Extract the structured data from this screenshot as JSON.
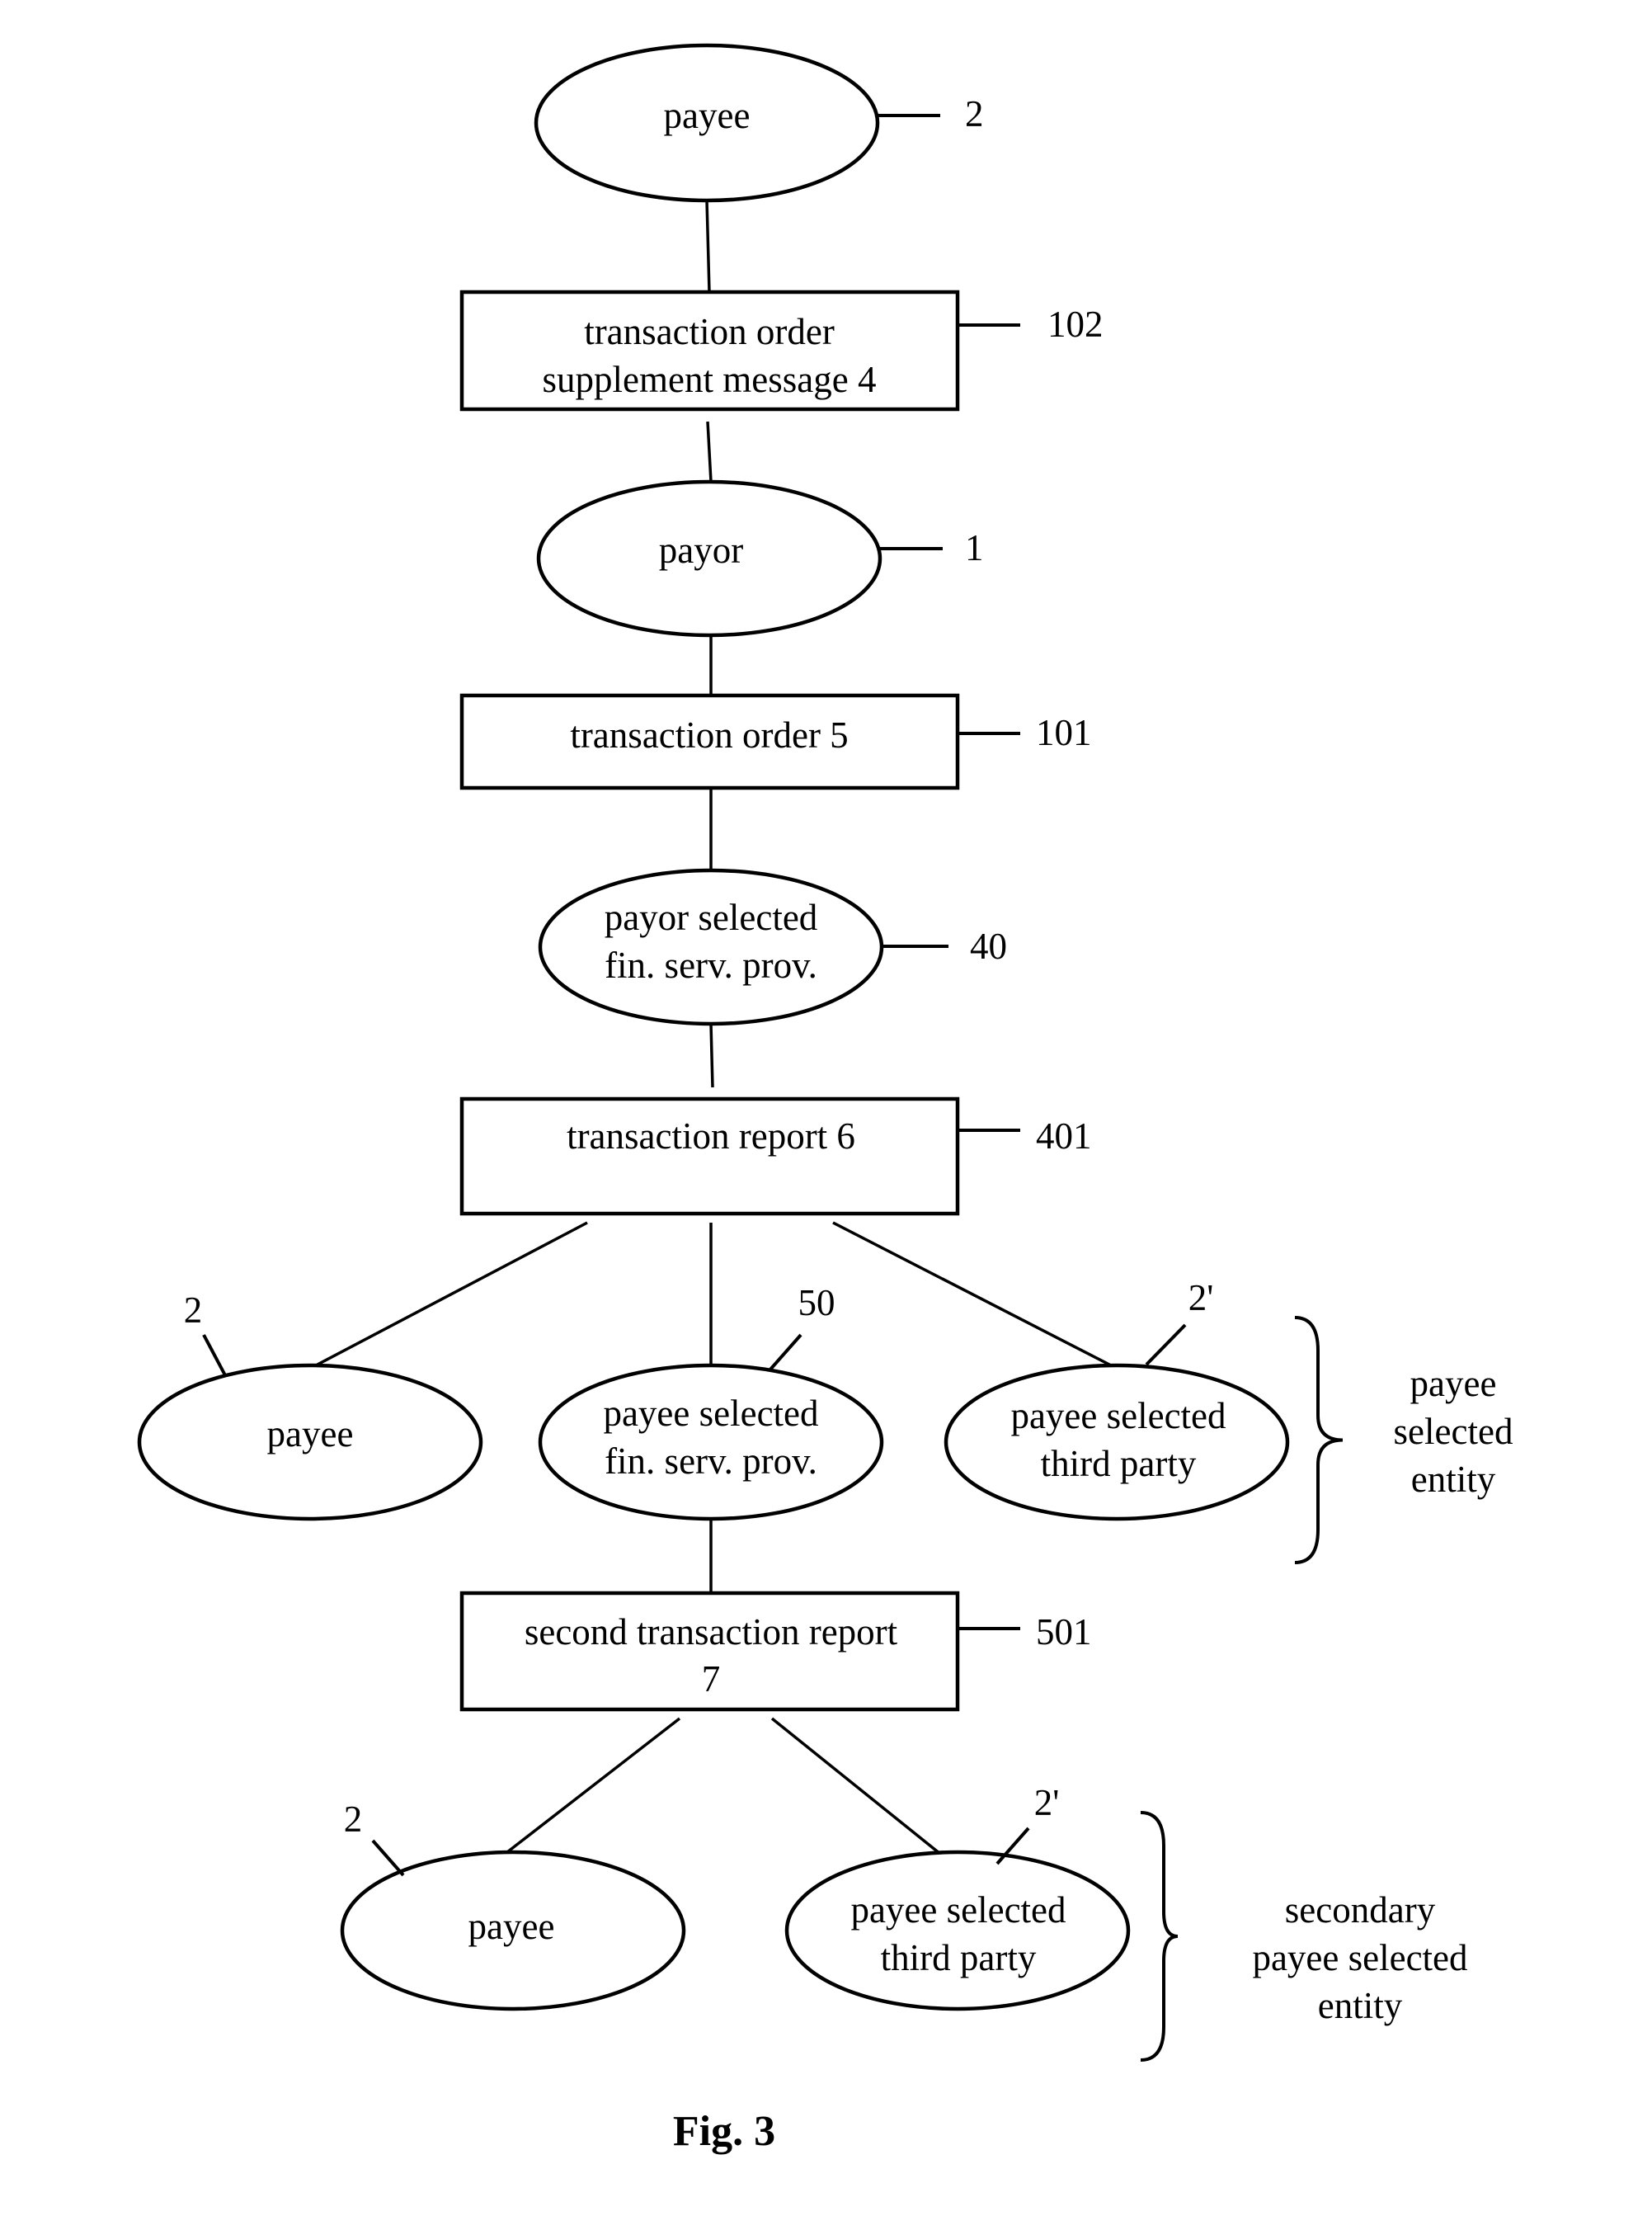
{
  "figure": {
    "caption": "Fig. 3",
    "nodes": {
      "payee_top": {
        "shape": "ellipse",
        "lines": [
          "payee"
        ],
        "ref": "2"
      },
      "supplement_message": {
        "shape": "box",
        "lines": [
          "transaction order",
          "supplement message 4"
        ],
        "ref": "102"
      },
      "payor": {
        "shape": "ellipse",
        "lines": [
          "payor"
        ],
        "ref": "1"
      },
      "transaction_order": {
        "shape": "box",
        "lines": [
          "transaction order 5"
        ],
        "ref": "101"
      },
      "payor_fsp": {
        "shape": "ellipse",
        "lines": [
          "payor selected",
          "fin. serv. prov."
        ],
        "ref": "40"
      },
      "transaction_report": {
        "shape": "box",
        "lines": [
          "transaction report 6"
        ],
        "ref": "401"
      },
      "payee_mid": {
        "shape": "ellipse",
        "lines": [
          "payee"
        ],
        "ref": "2"
      },
      "payee_fsp": {
        "shape": "ellipse",
        "lines": [
          "payee selected",
          "fin. serv. prov."
        ],
        "ref": "50"
      },
      "third_party_mid": {
        "shape": "ellipse",
        "lines": [
          "payee selected",
          "third party"
        ],
        "ref": "2'"
      },
      "second_report": {
        "shape": "box",
        "lines": [
          "second transaction report",
          "7"
        ],
        "ref": "501"
      },
      "payee_bottom": {
        "shape": "ellipse",
        "lines": [
          "payee"
        ],
        "ref": "2"
      },
      "third_party_bottom": {
        "shape": "ellipse",
        "lines": [
          "payee selected",
          "third party"
        ],
        "ref": "2'"
      }
    },
    "edges": [
      [
        "payee_top",
        "supplement_message"
      ],
      [
        "supplement_message",
        "payor"
      ],
      [
        "payor",
        "transaction_order"
      ],
      [
        "transaction_order",
        "payor_fsp"
      ],
      [
        "payor_fsp",
        "transaction_report"
      ],
      [
        "transaction_report",
        "payee_mid"
      ],
      [
        "transaction_report",
        "payee_fsp"
      ],
      [
        "transaction_report",
        "third_party_mid"
      ],
      [
        "payee_fsp",
        "second_report"
      ],
      [
        "second_report",
        "payee_bottom"
      ],
      [
        "second_report",
        "third_party_bottom"
      ]
    ],
    "groups": {
      "payee_selected_entity": {
        "lines": [
          "payee",
          "selected",
          "entity"
        ],
        "members": [
          "payee_mid",
          "payee_fsp",
          "third_party_mid"
        ]
      },
      "secondary_payee_selected_entity": {
        "lines": [
          "secondary",
          "payee selected",
          "entity"
        ],
        "members": [
          "payee_bottom",
          "third_party_bottom"
        ]
      }
    }
  }
}
